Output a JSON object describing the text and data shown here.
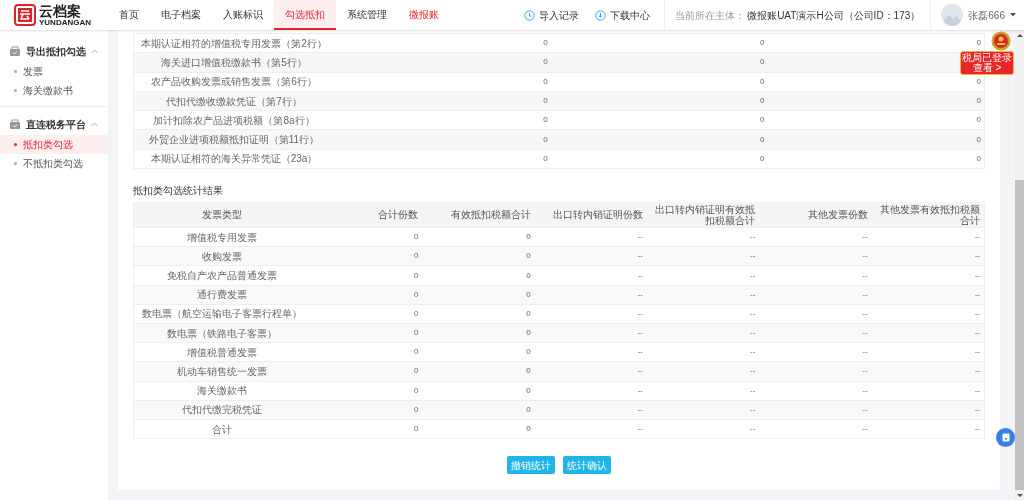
{
  "header": {
    "logo": {
      "name": "云档案",
      "subtitle": "YUNDANGAN"
    },
    "nav": [
      {
        "label": "首页",
        "selected": false,
        "kind": "normal"
      },
      {
        "label": "电子档案",
        "selected": false,
        "kind": "normal"
      },
      {
        "label": "入账标识",
        "selected": false,
        "kind": "normal"
      },
      {
        "label": "勾选抵扣",
        "selected": true,
        "kind": "normal"
      },
      {
        "label": "系统管理",
        "selected": false,
        "kind": "normal"
      },
      {
        "label": "微报账",
        "selected": false,
        "kind": "highlight"
      }
    ],
    "actions": [
      {
        "label": "导入记录",
        "kind": "clock"
      },
      {
        "label": "下载中心",
        "kind": "download"
      }
    ],
    "entity": {
      "label": "当前所在主体：",
      "value": "微报账UAT演示H公司（公司ID：173）"
    },
    "user": {
      "name": "张磊666"
    }
  },
  "sidebar": {
    "groups": [
      {
        "title": "导出抵扣勾选",
        "expanded": true,
        "items": [
          {
            "label": "发票",
            "selected": false
          },
          {
            "label": "海关缴款书",
            "selected": false
          }
        ]
      },
      {
        "title": "直连税务平台",
        "expanded": true,
        "items": [
          {
            "label": "抵扣类勾选",
            "selected": true
          },
          {
            "label": "不抵扣类勾选",
            "selected": false
          }
        ]
      }
    ]
  },
  "summary_table": {
    "rows": [
      {
        "label": "本期认证相符的增值税专用发票（第2行）",
        "column_2": "0",
        "column_3": "0",
        "column_4": "0"
      },
      {
        "label": "海关进口增值税缴款书（第5行）",
        "column_2": "0",
        "column_3": "0"
      },
      {
        "label": "农产品收购发票或销售发票（第6行）",
        "column_2": "0",
        "column_3": "0",
        "column_4": "0"
      },
      {
        "label": "代扣代缴收缴款凭证（第7行）",
        "column_2": "0",
        "column_3": "0",
        "column_4": "0"
      },
      {
        "label": "加计扣除农产品进项税额（第8a行）",
        "column_2": "0",
        "column_3": "0",
        "column_4": "0"
      },
      {
        "label": "外贸企业进项税额抵扣证明（第11行）",
        "column_2": "0",
        "column_3": "0",
        "column_4": "0"
      },
      {
        "label": "本期认证相符的海关异常凭证（23a）",
        "column_2": "0",
        "column_3": "0",
        "column_4": "0"
      }
    ]
  },
  "result": {
    "title": "抵扣类勾选统计结果",
    "columns": [
      "发票类型",
      "合计份数",
      "有效抵扣税额合计",
      "出口转内销证明份数",
      "出口转内销证明有效抵扣税额合计",
      "其他发票份数",
      "其他发票有效抵扣税额合计"
    ],
    "rows": [
      [
        "增值税专用发票",
        "0",
        "0",
        "--",
        "--",
        "--",
        "--"
      ],
      [
        "收购发票",
        "0",
        "0",
        "--",
        "--",
        "--",
        "--"
      ],
      [
        "免税自产农产品普通发票",
        "0",
        "0",
        "--",
        "--",
        "--",
        "--"
      ],
      [
        "通行费发票",
        "0",
        "0",
        "--",
        "--",
        "--",
        "--"
      ],
      [
        "数电票（航空运输电子客票行程单）",
        "0",
        "0",
        "--",
        "--",
        "--",
        "--"
      ],
      [
        "数电票（铁路电子客票）",
        "0",
        "0",
        "--",
        "--",
        "--",
        "--"
      ],
      [
        "增值税普通发票",
        "0",
        "0",
        "--",
        "--",
        "--",
        "--"
      ],
      [
        "机动车销售统一发票",
        "0",
        "0",
        "--",
        "--",
        "--",
        "--"
      ],
      [
        "海关缴款书",
        "0",
        "0",
        "--",
        "--",
        "--",
        "--"
      ],
      [
        "代扣代缴完税凭证",
        "0",
        "0",
        "--",
        "--",
        "--",
        "--"
      ],
      [
        "合计",
        "0",
        "0",
        "--",
        "--",
        "--",
        "--"
      ]
    ]
  },
  "buttons": [
    "撤销统计",
    "统计确认"
  ],
  "tax_badge": {
    "lines": [
      "税局已登录",
      "查看 >"
    ]
  }
}
